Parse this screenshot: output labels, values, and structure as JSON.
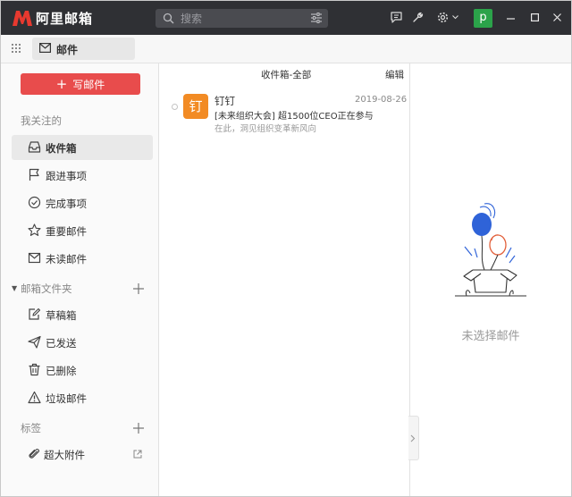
{
  "app": {
    "title": "阿里邮箱"
  },
  "search": {
    "placeholder": "搜索"
  },
  "user": {
    "avatar_letter": "p",
    "avatar_color": "#2ba34a"
  },
  "tabs": [
    {
      "label": "邮件"
    }
  ],
  "compose": {
    "label": "写邮件"
  },
  "sidebar": {
    "favorites_title": "我关注的",
    "favorites": [
      {
        "label": "收件箱",
        "icon": "inbox-icon",
        "active": true
      },
      {
        "label": "跟进事项",
        "icon": "flag-icon"
      },
      {
        "label": "完成事项",
        "icon": "check-circle-icon"
      },
      {
        "label": "重要邮件",
        "icon": "star-icon"
      },
      {
        "label": "未读邮件",
        "icon": "envelope-icon"
      }
    ],
    "folders_title": "邮箱文件夹",
    "folders": [
      {
        "label": "草稿箱",
        "icon": "draft-icon"
      },
      {
        "label": "已发送",
        "icon": "send-icon"
      },
      {
        "label": "已删除",
        "icon": "trash-icon"
      },
      {
        "label": "垃圾邮件",
        "icon": "warning-icon"
      }
    ],
    "tags_title": "标签",
    "attachments": {
      "label": "超大附件",
      "icon": "paperclip-icon"
    }
  },
  "list": {
    "title": "收件箱-全部",
    "edit_label": "编辑",
    "items": [
      {
        "avatar_char": "钉",
        "sender": "钉钉",
        "date": "2019-08-26",
        "subject": "[未来组织大会] 超1500位CEO正在参与",
        "preview": "在此，洞见组织变革新风向"
      }
    ]
  },
  "reader": {
    "empty_text": "未选择邮件"
  },
  "colors": {
    "accent": "#e84c4c",
    "titlebar": "#2f3034",
    "sender_avatar": "#f28b24"
  }
}
